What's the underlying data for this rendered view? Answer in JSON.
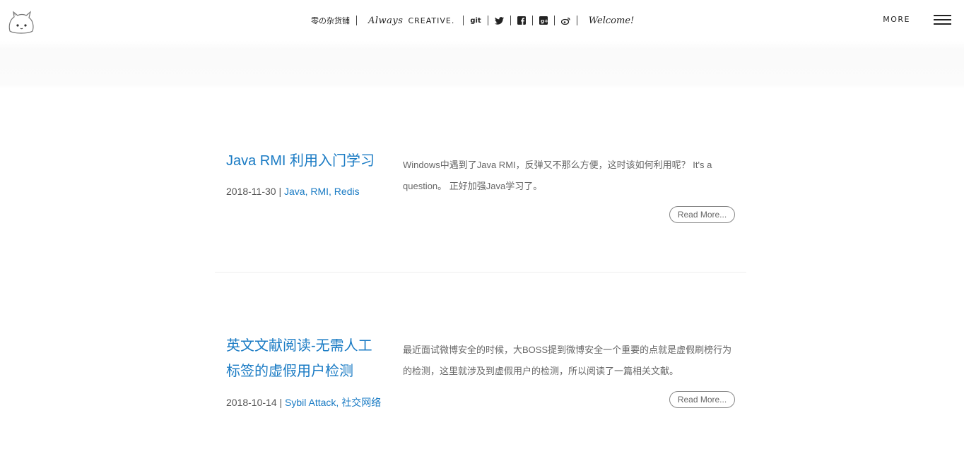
{
  "header": {
    "logo_icon": "cartoon-cat-logo",
    "site_name": "零の杂货铺",
    "slogan_italic": "Always",
    "slogan_caps": "CREATIVE.",
    "social": [
      {
        "name": "git-icon",
        "glyph": "git"
      },
      {
        "name": "twitter-icon",
        "glyph": "🐦"
      },
      {
        "name": "facebook-icon",
        "glyph": "f"
      },
      {
        "name": "google-plus-icon",
        "glyph": "g+"
      },
      {
        "name": "weibo-icon",
        "glyph": "微"
      }
    ],
    "welcome": "Welcome!",
    "more_label": "MORE",
    "menu_icon": "hamburger-menu-icon"
  },
  "posts": [
    {
      "title": "Java RMI 利用入门学习",
      "date": "2018-11-30",
      "tags": "Java, RMI, Redis",
      "excerpt": "Windows中遇到了Java RMI，反弹又不那么方便，这时该如何利用呢？ It's a question。 正好加强Java学习了。",
      "read_more": "Read More..."
    },
    {
      "title": "英文文献阅读-无需人工标签的虚假用户检测",
      "date": "2018-10-14",
      "tags": "Sybil Attack, 社交网络",
      "excerpt": "最近面试微博安全的时候，大BOSS提到微博安全一个重要的点就是虚假刷榜行为的检测，这里就涉及到虚假用户的检测，所以阅读了一篇相关文献。",
      "read_more": "Read More..."
    }
  ],
  "colors": {
    "link": "#1a7bc4",
    "text": "#555555"
  }
}
